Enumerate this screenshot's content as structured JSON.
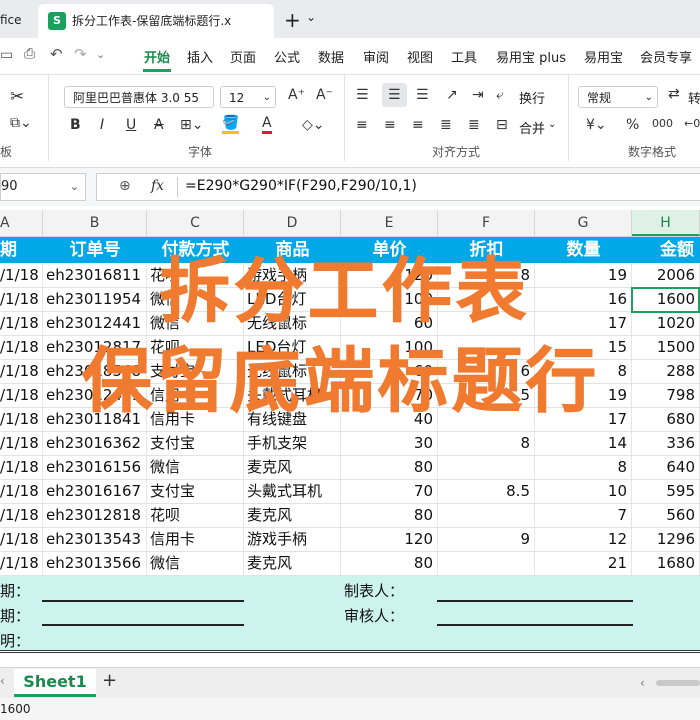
{
  "tabs": {
    "office": "fice",
    "doc_icon": "S",
    "doc_title": "拆分工作表-保留底端标题行.x",
    "add": "+",
    "more": "⌄"
  },
  "menu": [
    "开始",
    "插入",
    "页面",
    "公式",
    "数据",
    "审阅",
    "视图",
    "工具",
    "易用宝 plus",
    "易用宝",
    "会员专享"
  ],
  "ribbon": {
    "font_name": "阿里巴巴普惠体 3.0 55",
    "font_size": "12",
    "wrap_label": "换行",
    "merge_label": "合并",
    "number_format": "常规",
    "convert_label": "转",
    "group_font": "字体",
    "group_align": "对齐方式",
    "group_number": "数字格式",
    "group_clip": "板"
  },
  "formula": {
    "name_box": "90",
    "fx": "fx",
    "formula": "=E290*G290*IF(F290,F290/10,1)"
  },
  "columns": [
    "A",
    "B",
    "C",
    "D",
    "E",
    "F",
    "G",
    "H"
  ],
  "header": [
    "期",
    "订单号",
    "付款方式",
    "商品",
    "单价",
    "折扣",
    "数量",
    "金额"
  ],
  "rows": [
    [
      "/1/18",
      "eh23016811",
      "花呗",
      "游戏手柄",
      "120",
      "8",
      "19",
      "2006"
    ],
    [
      "/1/18",
      "eh23011954",
      "微信",
      "LED台灯",
      "100",
      "",
      "16",
      "1600"
    ],
    [
      "/1/18",
      "eh23012441",
      "微信",
      "无线鼠标",
      "60",
      "",
      "17",
      "1020"
    ],
    [
      "/1/18",
      "eh23012817",
      "花呗",
      "LED台灯",
      "100",
      "",
      "15",
      "1500"
    ],
    [
      "/1/18",
      "eh23018548",
      "支付宝",
      "无线鼠标",
      "60",
      "6",
      "8",
      "288"
    ],
    [
      "/1/18",
      "eh23012411",
      "信用卡",
      "头戴式耳机",
      "70",
      "5",
      "19",
      "798"
    ],
    [
      "/1/18",
      "eh23011841",
      "信用卡",
      "有线键盘",
      "40",
      "",
      "17",
      "680"
    ],
    [
      "/1/18",
      "eh23016362",
      "支付宝",
      "手机支架",
      "30",
      "8",
      "14",
      "336"
    ],
    [
      "/1/18",
      "eh23016156",
      "微信",
      "麦克风",
      "80",
      "",
      "8",
      "640"
    ],
    [
      "/1/18",
      "eh23016167",
      "支付宝",
      "头戴式耳机",
      "70",
      "8.5",
      "10",
      "595"
    ],
    [
      "/1/18",
      "eh23012818",
      "花呗",
      "麦克风",
      "80",
      "",
      "7",
      "560"
    ],
    [
      "/1/18",
      "eh23013543",
      "信用卡",
      "游戏手柄",
      "120",
      "9",
      "12",
      "1296"
    ],
    [
      "/1/18",
      "eh23013566",
      "微信",
      "麦克风",
      "80",
      "",
      "21",
      "1680"
    ]
  ],
  "footer": {
    "date1": "期：",
    "date2": "期：",
    "note": "明：",
    "maker": "制表人：",
    "reviewer": "审核人："
  },
  "overlay": {
    "line1": "拆分工作表",
    "line2": "保留底端标题行"
  },
  "sheet": {
    "name": "Sheet1",
    "add": "+"
  },
  "status": {
    "value": "1600"
  },
  "colors": {
    "header_bg": "#00a8e8",
    "footer_bg": "#cdf3ee",
    "overlay": "#f07a2f",
    "accent_green": "#1aa15e"
  }
}
